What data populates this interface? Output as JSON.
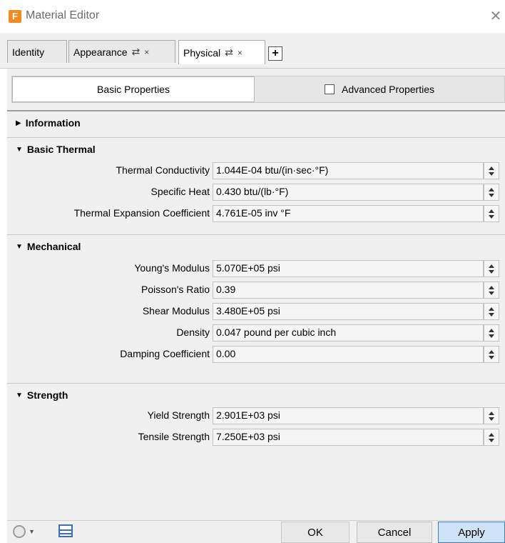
{
  "window": {
    "icon_letter": "F",
    "title": "Material Editor",
    "close_glyph": "✕"
  },
  "tabs": [
    {
      "label": "Identity"
    },
    {
      "label": "Appearance",
      "sync": "⇄",
      "close": "×"
    },
    {
      "label": "Physical",
      "sync": "⇄",
      "close": "×",
      "active": true
    }
  ],
  "add_tab": "+",
  "segments": {
    "basic": "Basic Properties",
    "advanced": "Advanced Properties",
    "advanced_checked": false
  },
  "sections": {
    "information": {
      "title": "Information",
      "expanded": false
    },
    "basic_thermal": {
      "title": "Basic Thermal",
      "rows": [
        {
          "label": "Thermal Conductivity",
          "value": "1.044E-04 btu/(in·sec·°F)"
        },
        {
          "label": "Specific Heat",
          "value": "0.430 btu/(lb·°F)"
        },
        {
          "label": "Thermal Expansion Coefficient",
          "value": "4.761E-05 inv °F"
        }
      ]
    },
    "mechanical": {
      "title": "Mechanical",
      "rows": [
        {
          "label": "Young's Modulus",
          "value": "5.070E+05 psi"
        },
        {
          "label": "Poisson's Ratio",
          "value": "0.39"
        },
        {
          "label": "Shear Modulus",
          "value": "3.480E+05 psi"
        },
        {
          "label": "Density",
          "value": "0.047 pound per cubic inch"
        },
        {
          "label": "Damping Coefficient",
          "value": "0.00"
        }
      ]
    },
    "strength": {
      "title": "Strength",
      "rows": [
        {
          "label": "Yield Strength",
          "value": "2.901E+03 psi"
        },
        {
          "label": "Tensile Strength",
          "value": "7.250E+03 psi"
        }
      ]
    }
  },
  "buttons": {
    "ok": "OK",
    "cancel": "Cancel",
    "apply": "Apply"
  },
  "colors": {
    "accent": "#3c7fc4",
    "app_icon": "#f28b1c"
  }
}
